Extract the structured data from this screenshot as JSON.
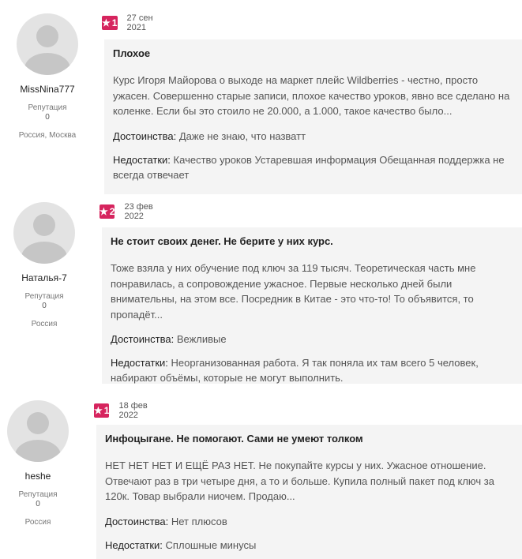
{
  "reviews": [
    {
      "user": {
        "name": "MissNina777",
        "reputation_label": "Репутация",
        "reputation_value": "0",
        "location": "Россия, Москва"
      },
      "rating": "1",
      "date": "27 сен 2021",
      "title": "Плохое",
      "text": "Курс Игоря Майорова о выходе на маркет плейс Wildberries - честно, просто ужасен. Совершенно старые записи, плохое качество уроков, явно все сделано на коленке. Если бы это стоило не 20.000, а 1.000, такое качество было...",
      "pros_label": "Достоинства:",
      "pros": "Даже не знаю, что назватт",
      "cons_label": "Недостатки:",
      "cons": "Качество уроков Устаревшая информация Обещанная поддержка не всегда отвечает"
    },
    {
      "user": {
        "name": "Наталья-7",
        "reputation_label": "Репутация",
        "reputation_value": "0",
        "location": "Россия"
      },
      "rating": "2",
      "date": "23 фев 2022",
      "title": "Не стоит своих денег. Не берите у них курс.",
      "text": "Тоже взяла у них обучение под ключ за 119 тысяч. Теоретическая часть мне понравилась, а сопровождение ужасное. Первые несколько дней были внимательны, на этом все. Посредник в Китае - это что-то! То объявится, то пропадёт...",
      "pros_label": "Достоинства:",
      "pros": "Вежливые",
      "cons_label": "Недостатки:",
      "cons": "Неорганизованная работа. Я так поняла их там всего 5 человек, набирают объёмы, которые не могут выполнить."
    },
    {
      "user": {
        "name": "heshe",
        "reputation_label": "Репутация",
        "reputation_value": "0",
        "location": "Россия"
      },
      "rating": "1",
      "date": "18 фев 2022",
      "title": "Инфоцыгане. Не помогают. Сами не умеют толком",
      "text": "НЕТ НЕТ НЕТ И ЕЩЁ РАЗ НЕТ. Не покупайте курсы у них. Ужасное отношение. Отвечают раз в три четыре дня, а то и больше. Купила полный пакет под ключ за 120к. Товар выбрали ниочем. Продаю...",
      "pros_label": "Достоинства:",
      "pros": "Нет плюсов",
      "cons_label": "Недостатки:",
      "cons": "Сплошные минусы"
    }
  ]
}
